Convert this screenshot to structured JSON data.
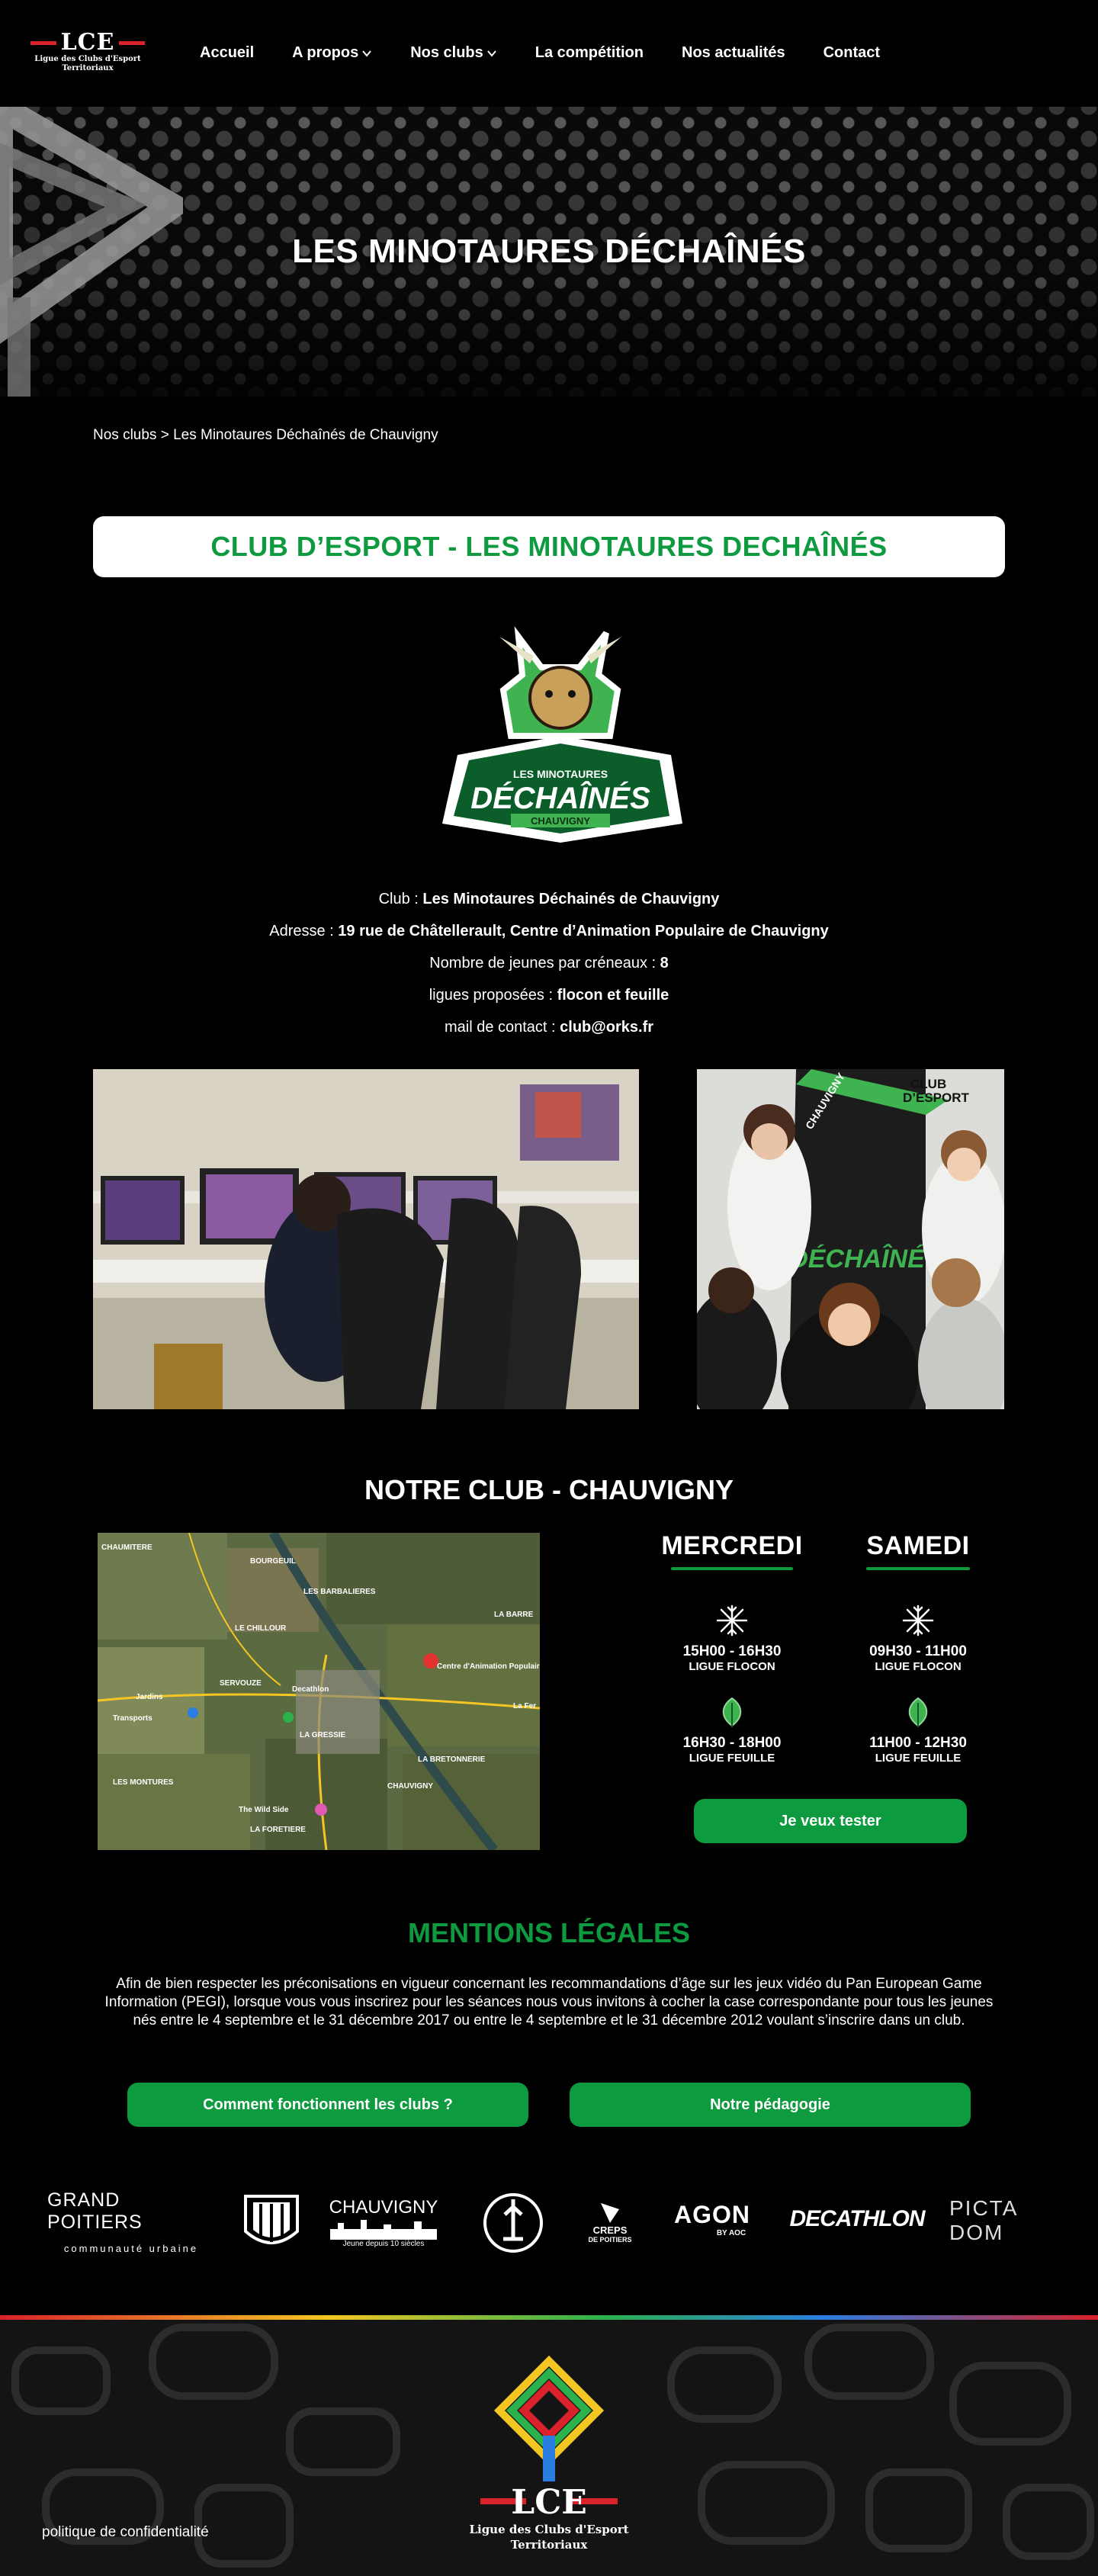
{
  "header": {
    "logo": {
      "mark": "LCE",
      "subtitle_line1": "Ligue des Clubs d'Esport",
      "subtitle_line2": "Territoriaux"
    },
    "nav": [
      {
        "label": "Accueil"
      },
      {
        "label": "A propos"
      },
      {
        "label": "Nos clubs"
      },
      {
        "label": "La compétition"
      },
      {
        "label": "Nos actualités"
      },
      {
        "label": "Contact"
      }
    ]
  },
  "banner": {
    "title": "LES MINOTAURES DÉCHAÎNÉS"
  },
  "breadcrumb": {
    "parent": "Nos clubs",
    "separator": ">",
    "current": "Les Minotaures Déchaînés de Chauvigny"
  },
  "club": {
    "title": "CLUB D’ESPORT - LES MINOTAURES DECHAÎNÉS",
    "logo": {
      "line1": "LES MINOTAURES",
      "line2": "DÉCHAÎNÉS",
      "line3": "CHAUVIGNY"
    },
    "info": [
      {
        "label": "Club :",
        "value": "Les Minotaures Déchainés de Chauvigny"
      },
      {
        "label": "Adresse :",
        "value": "19 rue de Châtellerault, Centre d’Animation Populaire de Chauvigny"
      },
      {
        "label": "Nombre de jeunes par créneaux :",
        "value": "8"
      },
      {
        "label": "ligues proposées :",
        "value": "flocon et feuille"
      },
      {
        "label": "mail de contact :",
        "value": "club@orks.fr"
      }
    ]
  },
  "photo2_banner": {
    "club_label_1": "CLUB",
    "club_label_2": "D’ESPORT",
    "city": "CHAUVIGNY",
    "logo_text": "DÉCHAÎNÉ"
  },
  "schedule": {
    "title": "NOTRE CLUB - CHAUVIGNY",
    "days": [
      {
        "name": "MERCREDI",
        "slots": [
          {
            "icon": "snowflake-icon",
            "time": "15H00 - 16H30",
            "league": "LIGUE FLOCON"
          },
          {
            "icon": "leaf-icon",
            "time": "16H30 - 18H00",
            "league": "LIGUE FEUILLE"
          }
        ]
      },
      {
        "name": "SAMEDI",
        "slots": [
          {
            "icon": "snowflake-icon",
            "time": "09H30 - 11H00",
            "league": "LIGUE FLOCON"
          },
          {
            "icon": "leaf-icon",
            "time": "11H00 - 12H30",
            "league": "LIGUE FEUILLE"
          }
        ]
      }
    ],
    "cta": "Je veux tester"
  },
  "map": {
    "labels": [
      "CHAUMITERE",
      "BOURGEUIL",
      "LES BARBALIERES",
      "LA BARRE",
      "LE CHILLOUR",
      "Centre d'Animation Populaire",
      "Jardins",
      "Transports",
      "SERVOUZE",
      "Decathlon",
      "LA GRESSIE",
      "LA BRETONNERIE",
      "LES MONTURES",
      "CHAUVIGNY",
      "The Wild Side",
      "LA FORETIERE",
      "La Fer"
    ]
  },
  "mentions": {
    "title": "MENTIONS LÉGALES",
    "text": "Afin de bien respecter les préconisations en vigueur concernant les recommandations d’âge sur les jeux vidéo du Pan European Game Information (PEGI), lorsque vous vous inscrirez pour les séances nous vous invitons à cocher la case correspondante pour tous les jeunes nés entre le 4 septembre et le 31 décembre 2017 ou entre le 4 septembre et le 31 décembre 2012 voulant s’inscrire dans un club."
  },
  "buttons": {
    "clubs": "Comment fonctionnent les clubs ?",
    "pedagogie": "Notre pédagogie"
  },
  "partners": {
    "grand_poitiers": {
      "main": "GRAND POITIERS",
      "sub": "communauté urbaine"
    },
    "chauvigny": {
      "main": "CHAUVIGNY",
      "sub": "Jeune depuis 10 siècles"
    },
    "creps": {
      "main": "CREPS",
      "sub": "DE POITIERS"
    },
    "agon": {
      "main": "AGON",
      "sub": "BY AOC"
    },
    "decathlon": {
      "main": "DECATHLON"
    },
    "pictadom": {
      "main": "PICTA DOM"
    }
  },
  "footer": {
    "logo": {
      "mark": "LCE",
      "subtitle_line1": "Ligue des Clubs d'Esport",
      "subtitle_line2": "Territoriaux"
    },
    "policy": "politique de confidentialité"
  },
  "colors": {
    "accent_green": "#0e9a3e",
    "brand_red": "#d9222b",
    "background": "#000000"
  }
}
